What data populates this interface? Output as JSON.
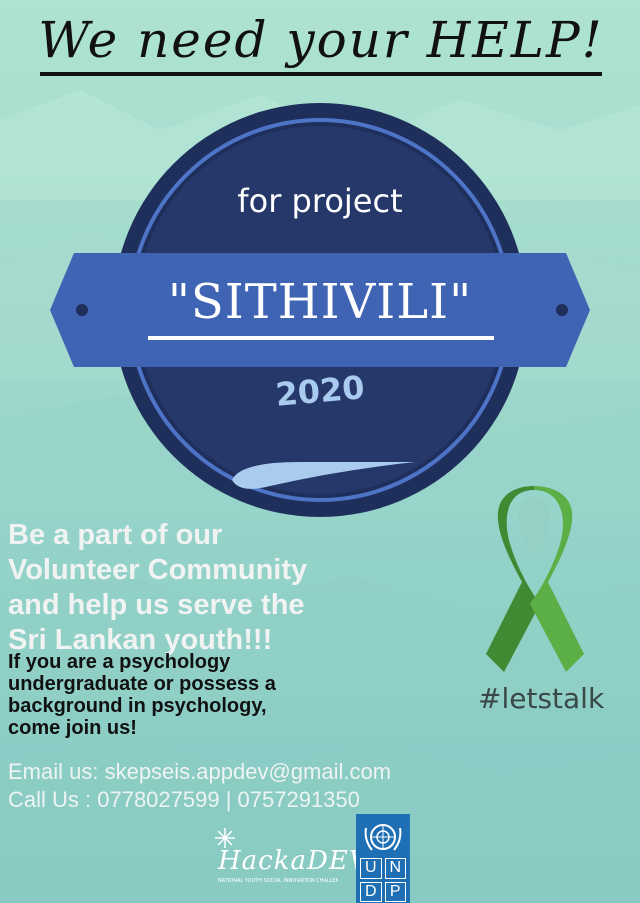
{
  "headline": "We need your HELP!",
  "badge": {
    "for_text": "for project",
    "project_name": "\"SITHIVILI\"",
    "year": "2020"
  },
  "call_to_action": {
    "lines": [
      "Be a part of our",
      "Volunteer Community",
      "and help us serve the",
      "Sri Lankan youth!!!"
    ]
  },
  "eligibility": {
    "lines": [
      "If you are a psychology",
      "undergraduate or possess a",
      "background in psychology,",
      "come join us!"
    ]
  },
  "contact": {
    "email_line": "Email us: skepseis.appdev@gmail.com",
    "phone_line": "Call Us : 0778027599 | 0757291350"
  },
  "hashtag": "#letstalk",
  "logos": {
    "hackadev": "HackaDEV",
    "hackadev_tagline": "NATIONAL YOUTH SOCIAL INNOVATION CHALLENGE",
    "undp_letters": [
      "U",
      "N",
      "D",
      "P"
    ]
  },
  "colors": {
    "background": "#9fd8cc",
    "badge_dark": "#1f2f5c",
    "banner_blue": "#3f64b4",
    "ribbon_green": "#4e9a3f",
    "undp_blue": "#1f6fb5"
  }
}
